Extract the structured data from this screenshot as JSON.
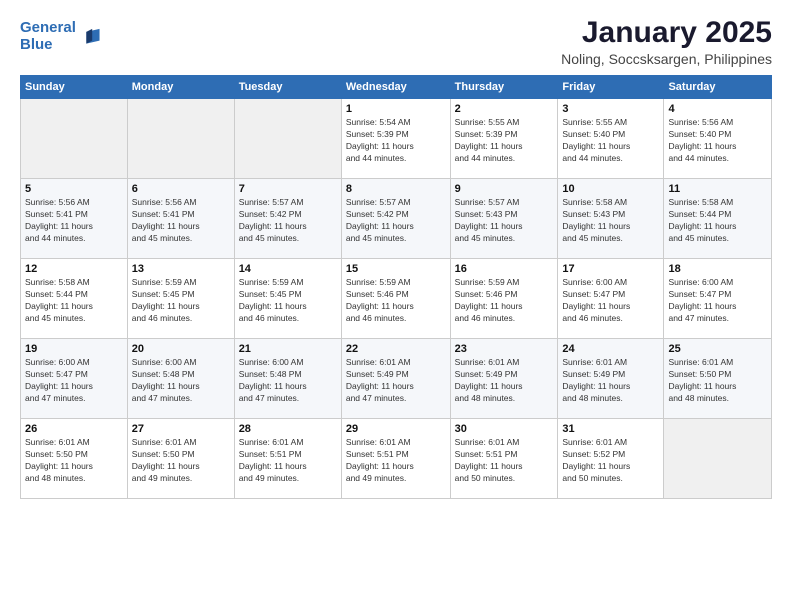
{
  "logo": {
    "line1": "General",
    "line2": "Blue"
  },
  "header": {
    "title": "January 2025",
    "subtitle": "Noling, Soccsksargen, Philippines"
  },
  "weekdays": [
    "Sunday",
    "Monday",
    "Tuesday",
    "Wednesday",
    "Thursday",
    "Friday",
    "Saturday"
  ],
  "weeks": [
    [
      {
        "day": "",
        "info": ""
      },
      {
        "day": "",
        "info": ""
      },
      {
        "day": "",
        "info": ""
      },
      {
        "day": "1",
        "info": "Sunrise: 5:54 AM\nSunset: 5:39 PM\nDaylight: 11 hours\nand 44 minutes."
      },
      {
        "day": "2",
        "info": "Sunrise: 5:55 AM\nSunset: 5:39 PM\nDaylight: 11 hours\nand 44 minutes."
      },
      {
        "day": "3",
        "info": "Sunrise: 5:55 AM\nSunset: 5:40 PM\nDaylight: 11 hours\nand 44 minutes."
      },
      {
        "day": "4",
        "info": "Sunrise: 5:56 AM\nSunset: 5:40 PM\nDaylight: 11 hours\nand 44 minutes."
      }
    ],
    [
      {
        "day": "5",
        "info": "Sunrise: 5:56 AM\nSunset: 5:41 PM\nDaylight: 11 hours\nand 44 minutes."
      },
      {
        "day": "6",
        "info": "Sunrise: 5:56 AM\nSunset: 5:41 PM\nDaylight: 11 hours\nand 45 minutes."
      },
      {
        "day": "7",
        "info": "Sunrise: 5:57 AM\nSunset: 5:42 PM\nDaylight: 11 hours\nand 45 minutes."
      },
      {
        "day": "8",
        "info": "Sunrise: 5:57 AM\nSunset: 5:42 PM\nDaylight: 11 hours\nand 45 minutes."
      },
      {
        "day": "9",
        "info": "Sunrise: 5:57 AM\nSunset: 5:43 PM\nDaylight: 11 hours\nand 45 minutes."
      },
      {
        "day": "10",
        "info": "Sunrise: 5:58 AM\nSunset: 5:43 PM\nDaylight: 11 hours\nand 45 minutes."
      },
      {
        "day": "11",
        "info": "Sunrise: 5:58 AM\nSunset: 5:44 PM\nDaylight: 11 hours\nand 45 minutes."
      }
    ],
    [
      {
        "day": "12",
        "info": "Sunrise: 5:58 AM\nSunset: 5:44 PM\nDaylight: 11 hours\nand 45 minutes."
      },
      {
        "day": "13",
        "info": "Sunrise: 5:59 AM\nSunset: 5:45 PM\nDaylight: 11 hours\nand 46 minutes."
      },
      {
        "day": "14",
        "info": "Sunrise: 5:59 AM\nSunset: 5:45 PM\nDaylight: 11 hours\nand 46 minutes."
      },
      {
        "day": "15",
        "info": "Sunrise: 5:59 AM\nSunset: 5:46 PM\nDaylight: 11 hours\nand 46 minutes."
      },
      {
        "day": "16",
        "info": "Sunrise: 5:59 AM\nSunset: 5:46 PM\nDaylight: 11 hours\nand 46 minutes."
      },
      {
        "day": "17",
        "info": "Sunrise: 6:00 AM\nSunset: 5:47 PM\nDaylight: 11 hours\nand 46 minutes."
      },
      {
        "day": "18",
        "info": "Sunrise: 6:00 AM\nSunset: 5:47 PM\nDaylight: 11 hours\nand 47 minutes."
      }
    ],
    [
      {
        "day": "19",
        "info": "Sunrise: 6:00 AM\nSunset: 5:47 PM\nDaylight: 11 hours\nand 47 minutes."
      },
      {
        "day": "20",
        "info": "Sunrise: 6:00 AM\nSunset: 5:48 PM\nDaylight: 11 hours\nand 47 minutes."
      },
      {
        "day": "21",
        "info": "Sunrise: 6:00 AM\nSunset: 5:48 PM\nDaylight: 11 hours\nand 47 minutes."
      },
      {
        "day": "22",
        "info": "Sunrise: 6:01 AM\nSunset: 5:49 PM\nDaylight: 11 hours\nand 47 minutes."
      },
      {
        "day": "23",
        "info": "Sunrise: 6:01 AM\nSunset: 5:49 PM\nDaylight: 11 hours\nand 48 minutes."
      },
      {
        "day": "24",
        "info": "Sunrise: 6:01 AM\nSunset: 5:49 PM\nDaylight: 11 hours\nand 48 minutes."
      },
      {
        "day": "25",
        "info": "Sunrise: 6:01 AM\nSunset: 5:50 PM\nDaylight: 11 hours\nand 48 minutes."
      }
    ],
    [
      {
        "day": "26",
        "info": "Sunrise: 6:01 AM\nSunset: 5:50 PM\nDaylight: 11 hours\nand 48 minutes."
      },
      {
        "day": "27",
        "info": "Sunrise: 6:01 AM\nSunset: 5:50 PM\nDaylight: 11 hours\nand 49 minutes."
      },
      {
        "day": "28",
        "info": "Sunrise: 6:01 AM\nSunset: 5:51 PM\nDaylight: 11 hours\nand 49 minutes."
      },
      {
        "day": "29",
        "info": "Sunrise: 6:01 AM\nSunset: 5:51 PM\nDaylight: 11 hours\nand 49 minutes."
      },
      {
        "day": "30",
        "info": "Sunrise: 6:01 AM\nSunset: 5:51 PM\nDaylight: 11 hours\nand 50 minutes."
      },
      {
        "day": "31",
        "info": "Sunrise: 6:01 AM\nSunset: 5:52 PM\nDaylight: 11 hours\nand 50 minutes."
      },
      {
        "day": "",
        "info": ""
      }
    ]
  ]
}
